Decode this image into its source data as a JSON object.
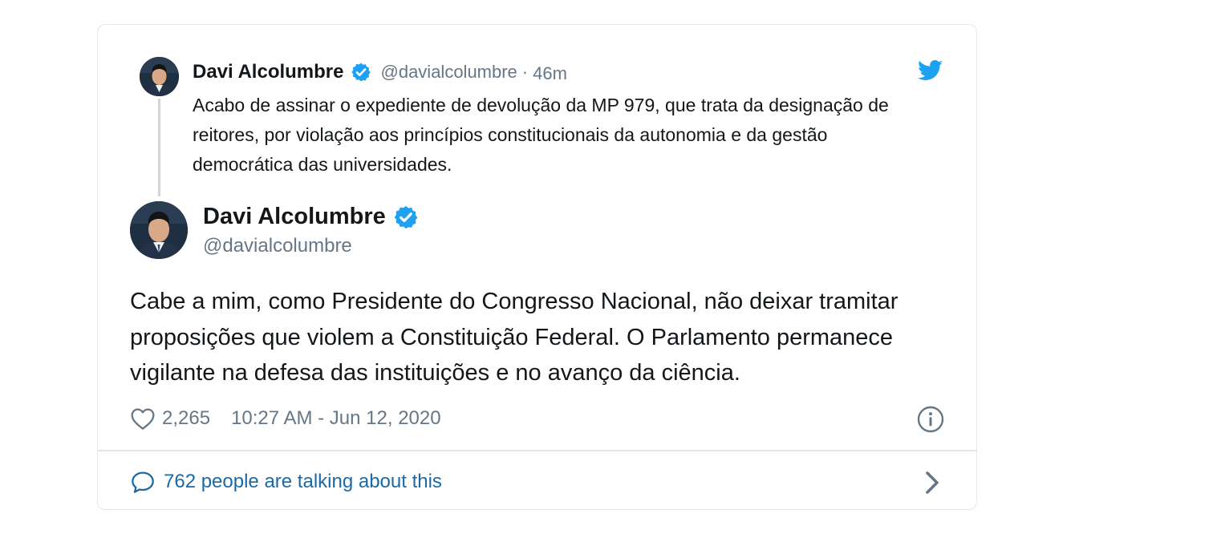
{
  "parent_tweet": {
    "author_name": "Davi Alcolumbre",
    "handle": "@davialcolumbre",
    "separator": "·",
    "time_ago": "46m",
    "text": "Acabo de assinar o expediente de devolução da MP 979, que trata da designação de reitores, por violação aos princípios constitucionais da autonomia e  da gestão democrática das universidades."
  },
  "main_tweet": {
    "author_name": "Davi Alcolumbre",
    "handle": "@davialcolumbre",
    "text": "Cabe a mim, como Presidente do Congresso Nacional, não deixar tramitar proposições que violem a Constituição Federal. O Parlamento permanece vigilante na defesa das instituições e no avanço da ciência.",
    "likes": "2,265",
    "timestamp": "10:27 AM - Jun 12, 2020"
  },
  "footer": {
    "talking_label": "762 people are talking about this"
  },
  "icons": {
    "twitter": "twitter-bird-icon",
    "verified": "verified-badge-icon",
    "heart": "heart-icon",
    "info": "info-icon",
    "comment": "comment-icon",
    "chevron": "chevron-right-icon"
  },
  "colors": {
    "twitter_blue": "#1da1f2",
    "text": "#14171a",
    "secondary": "#657786",
    "link": "#1b6aa5",
    "border": "#e1e8ed"
  }
}
